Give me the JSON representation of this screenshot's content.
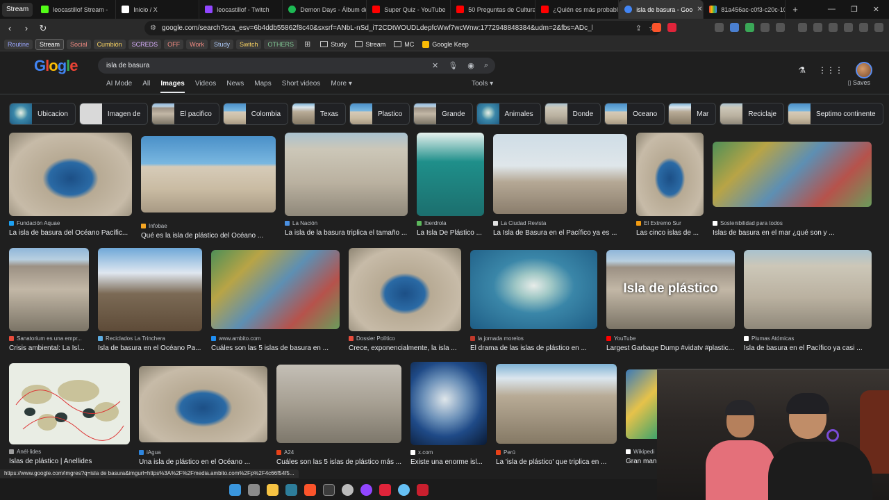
{
  "browser": {
    "tabs": [
      {
        "label": "Stream",
        "color": "#3a3a3a"
      },
      {
        "label": "leocastillof Stream - ",
        "color": "#53fc18"
      },
      {
        "label": "Inicio / X",
        "color": "#ffffff"
      },
      {
        "label": "leocastillof - Twitch",
        "color": "#9146ff"
      },
      {
        "label": "Demon Days - Álbum de",
        "color": "#1db954"
      },
      {
        "label": "Super Quiz - YouTube",
        "color": "#ff0000"
      },
      {
        "label": "50 Preguntas de Cultura",
        "color": "#ff0000"
      },
      {
        "label": "¿Quién es más probable",
        "color": "#ff0000"
      },
      {
        "label": "isla de basura - Goo",
        "color": "#4285f4"
      },
      {
        "label": "81a456ac-c0f3-c20c-10",
        "color": "#34a853"
      }
    ],
    "url": "google.com/search?sca_esv=6b4ddb55862f8c40&sxsrf=ANbL-nSd_iT2CDtWOUDLdepfcWwf7wcWnw:1772948848384&udm=2&fbs=ADc_l-aN0CWE...",
    "bookmarks": [
      {
        "label": "Routine",
        "color": "#9aa6ff"
      },
      {
        "label": "Stream",
        "color": "#ffffff"
      },
      {
        "label": "Social",
        "color": "#f28b82"
      },
      {
        "label": "Cumbión",
        "color": "#fdd663"
      },
      {
        "label": "SCREDS",
        "color": "#d7aefb"
      },
      {
        "label": "OFF",
        "color": "#f28b82"
      },
      {
        "label": "Work",
        "color": "#f28b82"
      },
      {
        "label": "Study",
        "color": "#aecbfa"
      },
      {
        "label": "Switch",
        "color": "#fdd663"
      },
      {
        "label": "OTHERS",
        "color": "#81c995"
      }
    ],
    "folders": [
      "Study",
      "Stream",
      "MC",
      "Google Keep"
    ],
    "status_url": "https://www.google.com/imgres?q=isla de basura&imgurl=https%3A%2F%2Fmedia.ambito.com%2Fp%2F4c66f54f5..."
  },
  "google": {
    "logo": [
      "G",
      "l",
      "o",
      "g",
      "l",
      "e"
    ],
    "query": "isla de basura",
    "tabs": [
      "AI Mode",
      "All",
      "Images",
      "Videos",
      "News",
      "Maps",
      "Short videos",
      "More ▾"
    ],
    "active_tab": "Images",
    "tools": "Tools ▾",
    "saves": "Saves",
    "chips": [
      "Ubicacion",
      "Imagen de",
      "El pacifico",
      "Colombia",
      "Texas",
      "Plastico",
      "Grande",
      "Animales",
      "Donde",
      "Oceano",
      "Mar",
      "Reciclaje",
      "Septimo continente"
    ]
  },
  "results": {
    "row1": [
      {
        "source": "Fundación Aquae",
        "title": "La isla de basura del Océano Pacífic...",
        "src_color": "#1da1f2"
      },
      {
        "source": "Infobae",
        "title": "Qué es la isla de plástico del Océano ...",
        "src_color": "#f5a623"
      },
      {
        "source": "La Nación",
        "title": "La isla de la basura triplica el tamaño ...",
        "src_color": "#4a90e2"
      },
      {
        "source": "Iberdrola",
        "title": "La Isla De Plástico ...",
        "src_color": "#5cb85c"
      },
      {
        "source": "La Ciudad Revista",
        "title": "La Isla de Basura en el Pacífico ya es ...",
        "src_color": "#e0e0e0"
      },
      {
        "source": "El Extremo Sur",
        "title": "Las cinco islas de ...",
        "src_color": "#f39c12"
      },
      {
        "source": "Sostenibilidad para todos",
        "title": "Islas de basura en el mar ¿qué son y ...",
        "src_color": "#ffffff"
      }
    ],
    "row2": [
      {
        "source": "Sanatorium es una empr...",
        "title": "Crisis ambiental: La Isl...",
        "src_color": "#e74c3c"
      },
      {
        "source": "Reciclados La Trinchera",
        "title": "Isla de basura en el Océano Pa...",
        "src_color": "#5dade2"
      },
      {
        "source": "www.ambito.com",
        "title": "Cuáles son las 5 islas de basura en ...",
        "src_color": "#1f8ef1"
      },
      {
        "source": "Dossier Político",
        "title": "Crece, exponencialmente, la isla ...",
        "src_color": "#e74c3c"
      },
      {
        "source": "la jornada morelos",
        "title": "El drama de las islas de plástico en ...",
        "src_color": "#c0392b"
      },
      {
        "source": "YouTube",
        "title": "Largest Garbage Dump #vidatv #plastic...",
        "src_color": "#ff0000",
        "overlay": "Isla de plástico"
      },
      {
        "source": "Plumas Atómicas",
        "title": "Isla de basura en el Pacífico ya casi ...",
        "src_color": "#ffffff"
      }
    ],
    "row3": [
      {
        "source": "Anél·lides",
        "title": "Islas de plástico | Anellides",
        "src_color": "#9e9e9e"
      },
      {
        "source": "iAgua",
        "title": "Una isla de plástico en el Océano ...",
        "src_color": "#2e86de"
      },
      {
        "source": "A24",
        "title": "Cuáles son las 5 islas de plástico más ...",
        "src_color": "#e84118"
      },
      {
        "source": "x.com",
        "title": "Existe una enorme isl...",
        "src_color": "#ffffff"
      },
      {
        "source": "Perú",
        "title": "La 'isla de plástico' que triplica en ...",
        "src_color": "#e84118"
      },
      {
        "source": "Wikipedi",
        "title": "Gran man",
        "src_color": "#ffffff"
      }
    ]
  },
  "taskbar": {
    "icons": [
      {
        "name": "windows-icon",
        "color": "#3a96dd"
      },
      {
        "name": "task-view-icon",
        "color": "#8a8a8a"
      },
      {
        "name": "file-explorer-icon",
        "color": "#f6c343"
      },
      {
        "name": "store-icon",
        "color": "#2d7d9a"
      },
      {
        "name": "brave-icon",
        "color": "#fb542b"
      },
      {
        "name": "obs-icon",
        "color": "#3c3c3c"
      },
      {
        "name": "app-icon",
        "color": "#bbbbbb"
      },
      {
        "name": "twitch-icon",
        "color": "#9146ff"
      },
      {
        "name": "red-app-icon",
        "color": "#e0243a"
      },
      {
        "name": "steam-icon",
        "color": "#66c0f4"
      },
      {
        "name": "game-icon",
        "color": "#c91f2e"
      }
    ]
  }
}
